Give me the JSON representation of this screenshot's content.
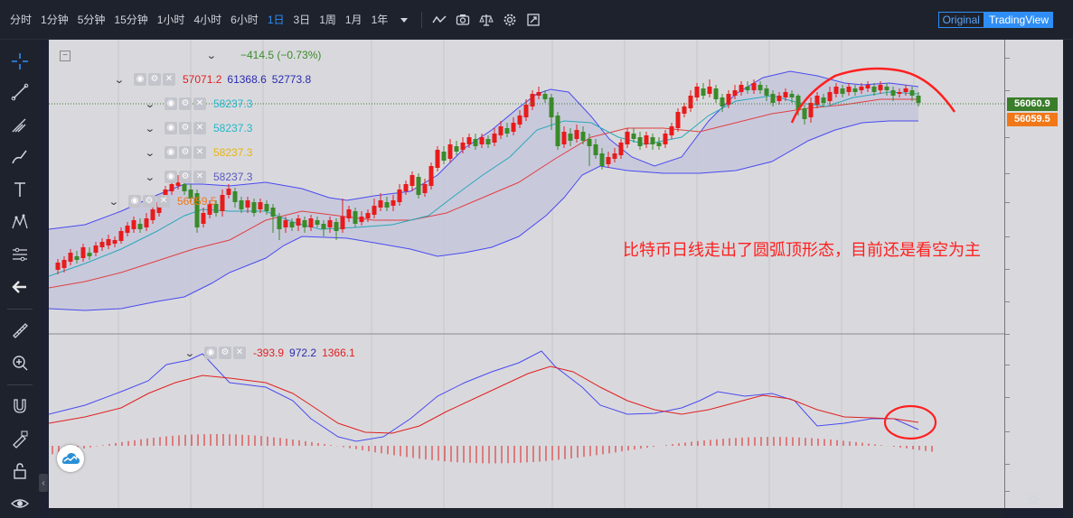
{
  "toolbar": {
    "timeframes": [
      {
        "label": "分时",
        "active": false
      },
      {
        "label": "1分钟",
        "active": false
      },
      {
        "label": "5分钟",
        "active": false
      },
      {
        "label": "15分钟",
        "active": false
      },
      {
        "label": "1小时",
        "active": false
      },
      {
        "label": "4小时",
        "active": false
      },
      {
        "label": "6小时",
        "active": false
      },
      {
        "label": "1日",
        "active": true
      },
      {
        "label": "3日",
        "active": false
      },
      {
        "label": "1周",
        "active": false
      },
      {
        "label": "1月",
        "active": false
      },
      {
        "label": "1年",
        "active": false
      }
    ],
    "icons": [
      "dropdown-caret-icon",
      "line-chart-icon",
      "camera-icon",
      "scale-icon",
      "gear-icon",
      "fullscreen-icon"
    ],
    "view_original": "Original",
    "view_tradingview": "TradingView"
  },
  "left_tools": [
    "crosshair-icon",
    "trend-line-icon",
    "pitchfork-icon",
    "brush-icon",
    "text-icon",
    "pattern-icon",
    "long-short-icon",
    "back-arrow-icon",
    "ruler-icon",
    "zoom-in-icon",
    "magnet-icon",
    "lock-drawing-icon",
    "lock-icon",
    "eye-icon"
  ],
  "legend": {
    "main_change": "−414.5 (−0.73%)",
    "boll": {
      "upper": "57071.2",
      "middle": "61368.6",
      "lower": "52773.8"
    },
    "ma1": "58237.3",
    "ma2": "58237.3",
    "ma3": "58237.3",
    "ma4": "58237.3",
    "ma5": "56059.5",
    "macd": {
      "hist": "-393.9",
      "dif": "972.2",
      "dea": "1366.1"
    }
  },
  "price_labels": {
    "current": "56060.9",
    "ma": "56059.5"
  },
  "annotation": "比特币日线走出了圆弧顶形态，目前还是看空为主",
  "colors": {
    "up": "#e81b1b",
    "down": "#3a8a2a",
    "boll_band": "#4a4af0",
    "boll_fill": "#c8c8e0",
    "ma_teal": "#2aa8b8",
    "ma_red": "#e04040",
    "price_green": "#3a7d2a",
    "price_orange": "#f07818",
    "annotation_red": "#ff2020"
  }
}
